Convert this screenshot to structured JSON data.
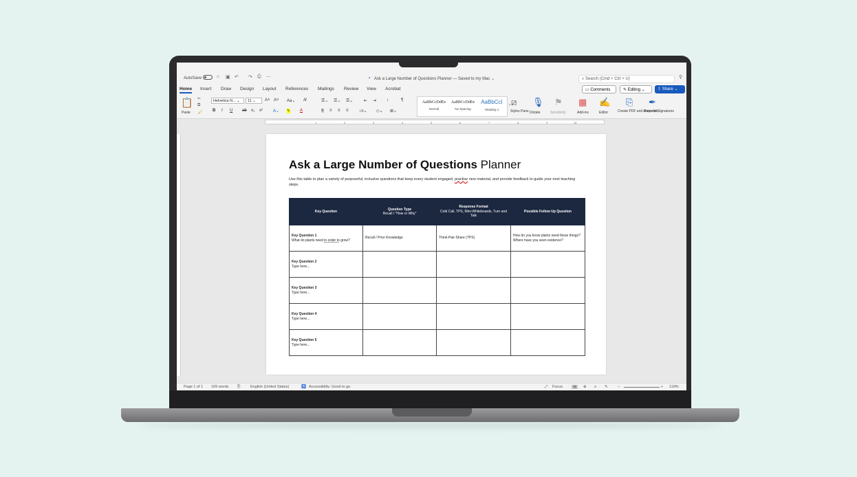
{
  "titlebar": {
    "autosave": "AutoSave",
    "doc_title": "Ask a Large Number of Questions Planner — Saved to my Mac ⌄",
    "search_placeholder": "Search (Cmd + Ctrl + U)"
  },
  "menu": [
    "Home",
    "Insert",
    "Draw",
    "Design",
    "Layout",
    "References",
    "Mailings",
    "Review",
    "View",
    "Acrobat"
  ],
  "buttons": {
    "comments": "Comments",
    "editing": "Editing",
    "share": "Share"
  },
  "ribbon": {
    "paste": "Paste",
    "font_name": "Helvetica N...",
    "font_size": "11",
    "styles": [
      {
        "sample": "AaBbCcDdEe",
        "name": "Normal"
      },
      {
        "sample": "AaBbCcDdEe",
        "name": "No Spacing"
      },
      {
        "sample": "AaBbCcI",
        "name": "Heading 1"
      }
    ],
    "tools": {
      "styles_pane": "Styles Pane",
      "dictate": "Dictate",
      "sensitivity": "Sensitivity",
      "addins": "Add-ins",
      "editor": "Editor",
      "create_pdf": "Create PDF and share link",
      "request_sig": "Request Signatures"
    }
  },
  "ruler_numbers": [
    "1",
    "2",
    "3",
    "4",
    "5",
    "6",
    "7",
    "8",
    "9",
    "10"
  ],
  "document": {
    "title_bold": "Ask a Large Number of Questions",
    "title_rest": " Planner",
    "intro_a": "Use this table to plan a variety of purposeful, inclusive questions that keep every student engaged, ",
    "intro_sq": "practise",
    "intro_b": " new material, and provide feedback to guide your next teaching steps.",
    "headers": [
      {
        "title": "Key Question",
        "sub": ""
      },
      {
        "title": "Question Type",
        "sub": "Recall / \"How or Why\""
      },
      {
        "title": "Response Format",
        "sub": "Cold Call, TPS, Mini-Whiteboards, Turn and Talk"
      },
      {
        "title": "Possible Follow Up Question",
        "sub": ""
      }
    ],
    "rows": [
      {
        "label": "Key Question 1",
        "text_a": "What do plants need ",
        "text_u": "in order to",
        "text_b": " grow?",
        "type": "Recall / Prior Knowledge",
        "format": "Think-Pair-Share (TPS)",
        "follow": "How do you know plants need these things? Where have you seen evidence?"
      },
      {
        "label": "Key Question 2",
        "text_a": "Type here...",
        "text_u": "",
        "text_b": "",
        "type": "",
        "format": "",
        "follow": ""
      },
      {
        "label": "Key Question 3",
        "text_a": "Type here...",
        "text_u": "",
        "text_b": "",
        "type": "",
        "format": "",
        "follow": ""
      },
      {
        "label": "Key Question 4",
        "text_a": "Type here...",
        "text_u": "",
        "text_b": "",
        "type": "",
        "format": "",
        "follow": ""
      },
      {
        "label": "Key Question 5",
        "text_a": "Type here...",
        "text_u": "",
        "text_b": "",
        "type": "",
        "format": "",
        "follow": ""
      }
    ]
  },
  "status": {
    "page": "Page 1 of 1",
    "words": "109 words",
    "language": "English (United States)",
    "accessibility": "Accessibility: Good to go",
    "focus": "Focus",
    "zoom": "119%"
  }
}
